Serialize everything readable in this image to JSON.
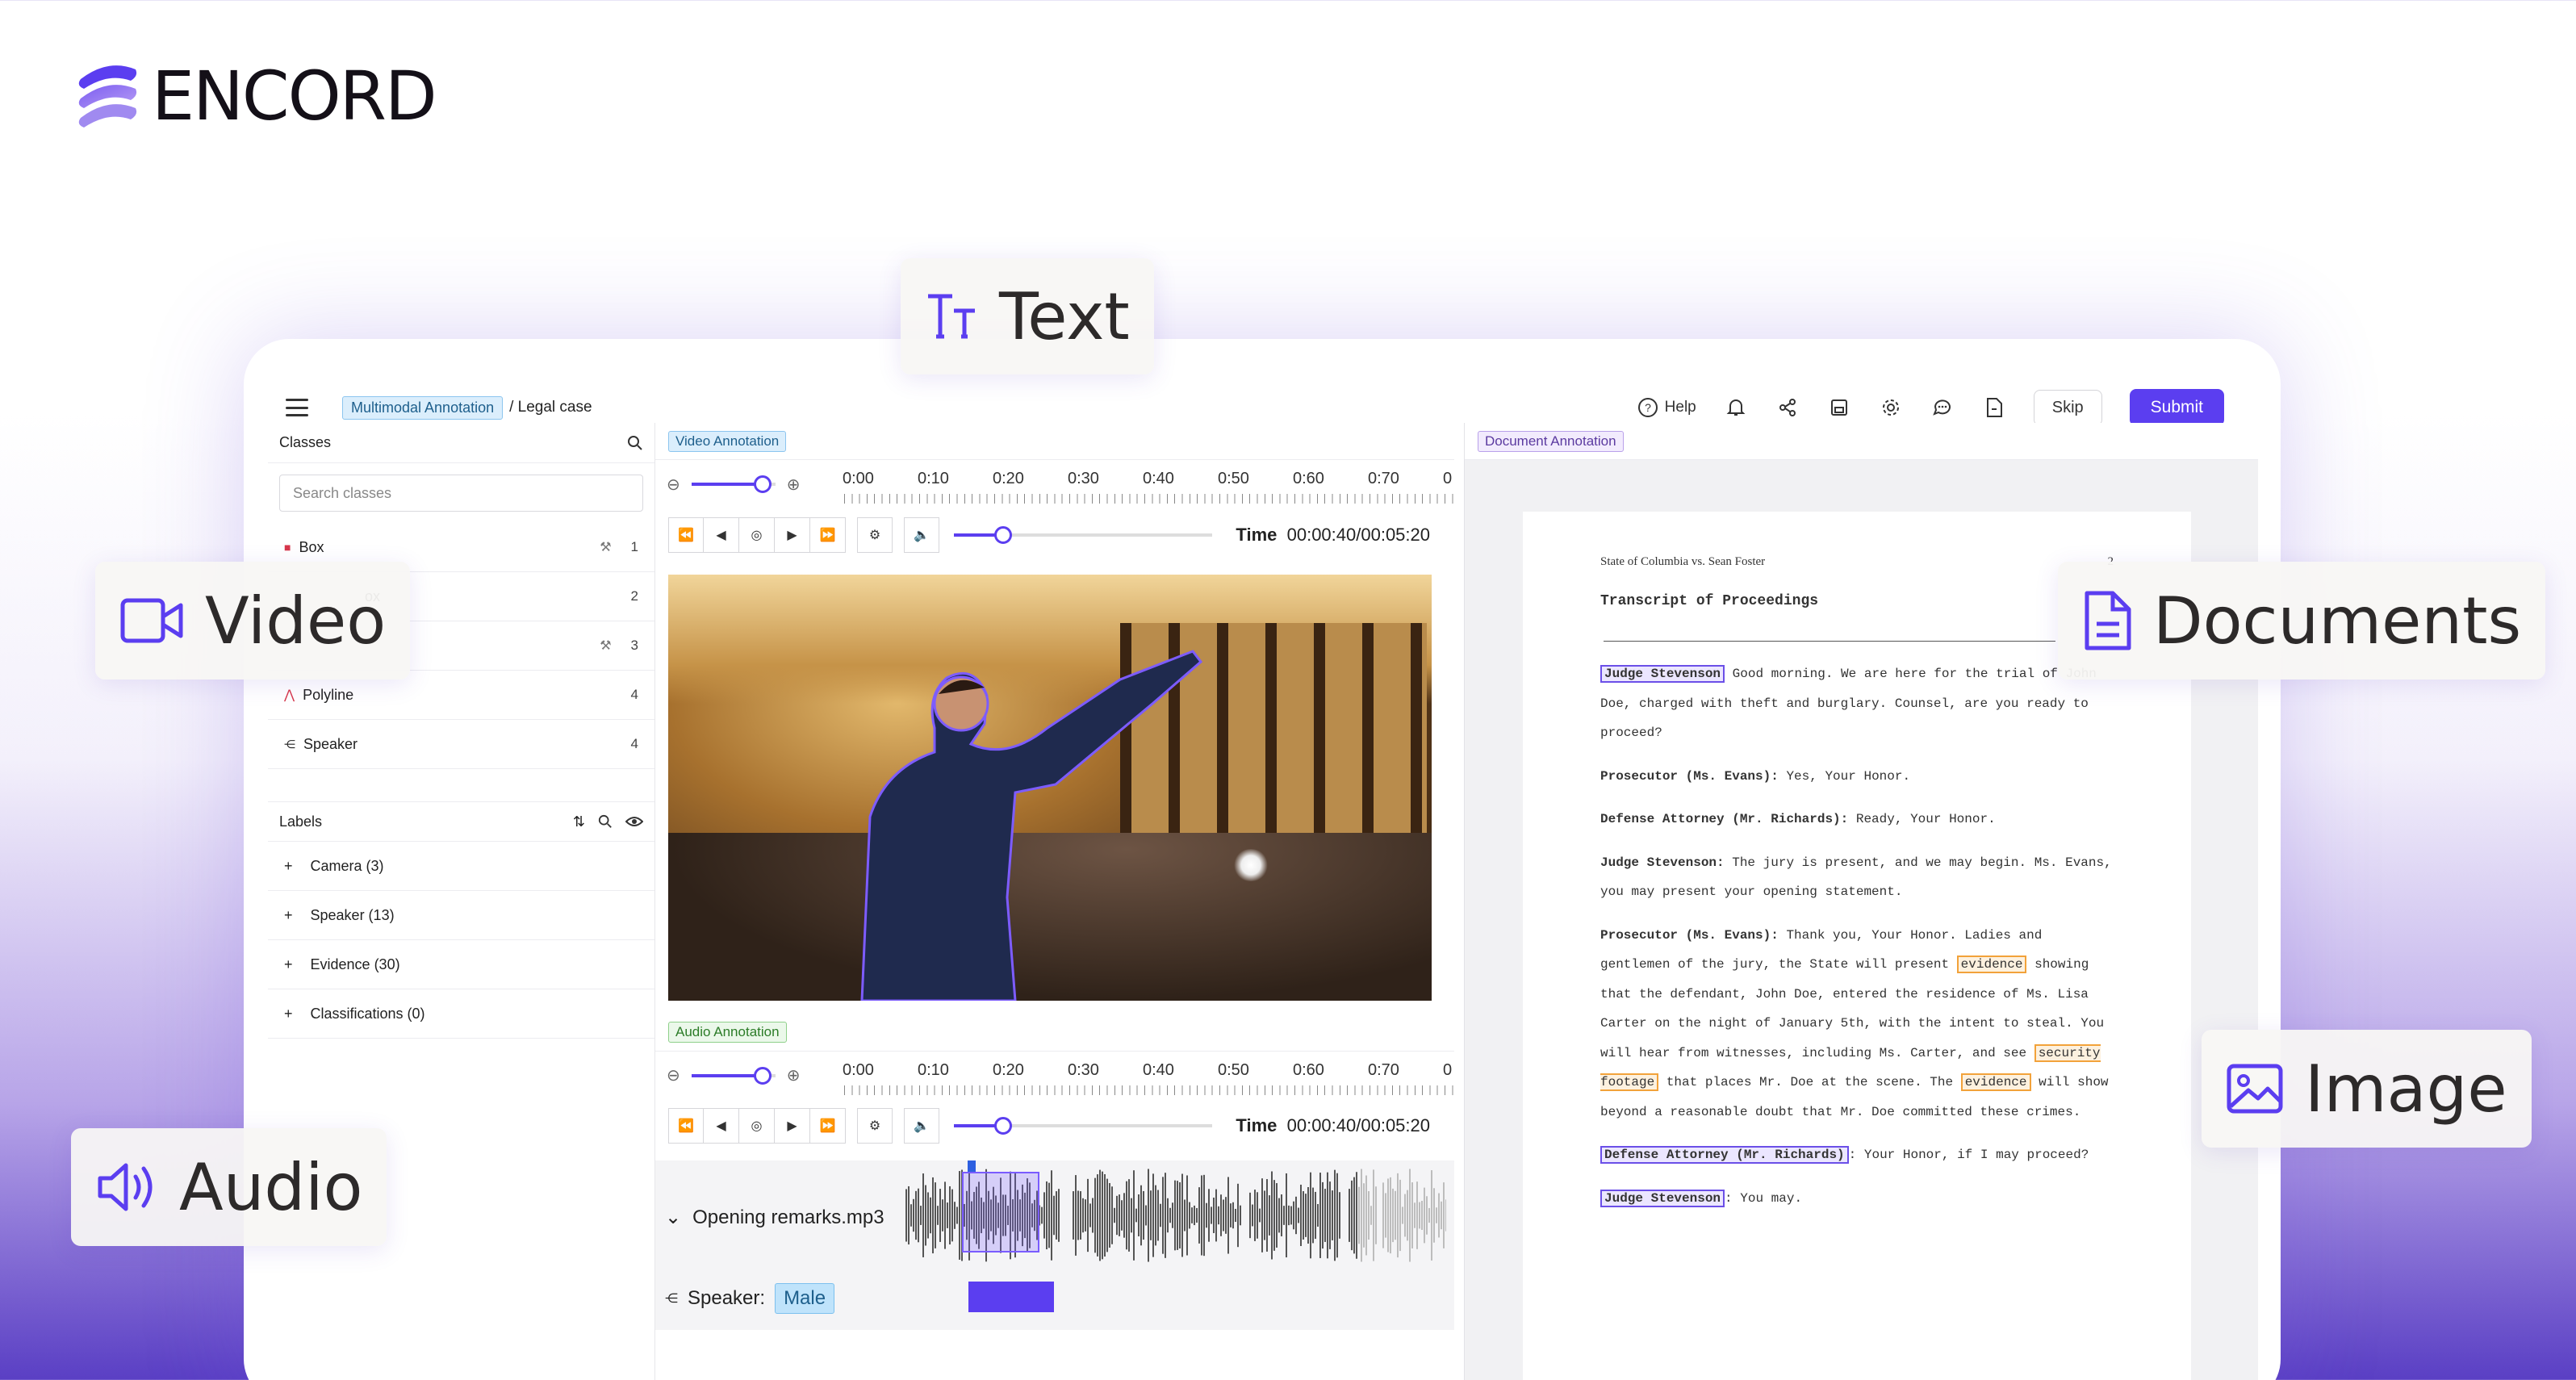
{
  "brand": {
    "name": "ENCORD"
  },
  "badges": {
    "text": "Text",
    "video": "Video",
    "documents": "Documents",
    "image": "Image",
    "audio": "Audio"
  },
  "topbar": {
    "breadcrumb_tag": "Multimodal Annotation",
    "breadcrumb_rest": "/ Legal case",
    "help": "Help",
    "skip": "Skip",
    "submit": "Submit"
  },
  "sidebar": {
    "classes_title": "Classes",
    "search_placeholder": "Search classes",
    "classes": [
      {
        "label": "Box",
        "count": "1"
      },
      {
        "label": "ox",
        "count": "2"
      },
      {
        "label": "",
        "count": "3"
      },
      {
        "label": "Polyline",
        "count": "4"
      },
      {
        "label": "Speaker",
        "count": "4"
      }
    ],
    "labels_title": "Labels",
    "labels": [
      "Camera (3)",
      "Speaker (13)",
      "Evidence (30)",
      "Classifications (0)"
    ]
  },
  "video": {
    "title": "Video Annotation",
    "ticks": [
      "0:00",
      "0:10",
      "0:20",
      "0:30",
      "0:40",
      "0:50",
      "0:60",
      "0:70",
      "0"
    ],
    "time_label": "Time",
    "time_value": "00:00:40/00:05:20",
    "zoom": 0.85,
    "playback": 0.19
  },
  "audio": {
    "title": "Audio Annotation",
    "ticks": [
      "0:00",
      "0:10",
      "0:20",
      "0:30",
      "0:40",
      "0:50",
      "0:60",
      "0:70",
      "0"
    ],
    "time_label": "Time",
    "time_value": "00:00:40/00:05:20",
    "file": "Opening remarks.mp3",
    "speaker_label": "Speaker:",
    "speaker_value": "Male",
    "zoom": 0.85,
    "playback": 0.19
  },
  "document": {
    "title": "Document Annotation",
    "header_left": "State of Columbia vs. Sean Foster",
    "header_right": "2",
    "heading": "Transcript of Proceedings",
    "p1_name": "Judge Stevenson",
    "p1_text": " Good morning. We are here for the trial of John Doe, charged with theft and burglary. Counsel, are you ready to proceed?",
    "p2_name": "Prosecutor (Ms. Evans):",
    "p2_text": " Yes, Your Honor.",
    "p3_name": "Defense Attorney (Mr. Richards):",
    "p3_text": " Ready, Your Honor.",
    "p4_name": "Judge Stevenson:",
    "p4_text": " The jury is present, and we may begin. Ms. Evans, you may present your opening statement.",
    "p5_name": "Prosecutor (Ms. Evans):",
    "p5_a": " Thank you, Your Honor. Ladies and gentlemen of the jury, the State will present ",
    "p5_ev1": "evidence",
    "p5_b": " showing that the defendant, John Doe, entered the residence of Ms. Lisa Carter on the night of January 5th, with the intent to steal. You will hear from witnesses, including Ms. Carter, and see ",
    "p5_sf": "security footage",
    "p5_c": " that places Mr. Doe at the scene. The ",
    "p5_ev2": "evidence",
    "p5_d": " will show beyond a reasonable doubt that Mr. Doe committed these crimes.",
    "p6_name": "Defense Attorney (Mr. Richards)",
    "p6_text": ": Your Honor, if I may proceed?",
    "p7_name": "Judge Stevenson",
    "p7_text": ": You may."
  }
}
